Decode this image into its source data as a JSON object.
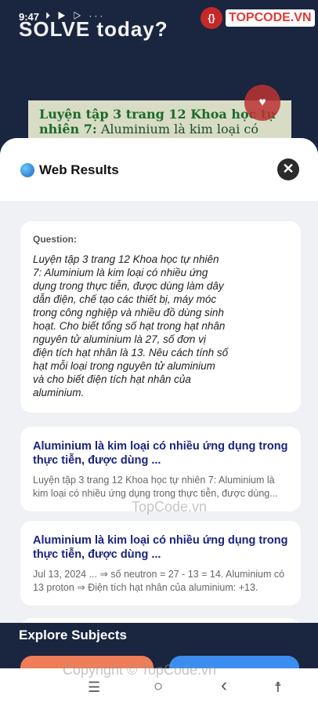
{
  "status": {
    "time": "9:47",
    "icons": "⏵ ▶ ▷ ···"
  },
  "background": {
    "title": "SOLVE today?",
    "card_highlight": "Luyện tập 3 trang 12 Khoa học tự nhiên 7:",
    "card_rest": " Aluminium là kim loại có"
  },
  "logo": {
    "badge": "{}",
    "text": "TOPCODE.VN"
  },
  "sheet": {
    "title": "Web Results",
    "close_icon": "✕"
  },
  "question": {
    "label": "Question:",
    "text": "Luyện tập 3 trang 12 Khoa học tự nhiên 7: Aluminium là kim loại có nhiều ứng dụng trong thực tiễn, được dùng làm dây dẫn điện, chế tạo các thiết bị, máy móc trong công nghiệp và nhiều đồ dùng sinh hoạt. Cho biết tổng số hạt trong hạt nhân nguyên tử aluminium là 27, số đơn vị điện tích hạt nhân là 13. Nêu cách tính số hạt mỗi loại trong nguyên tử aluminium và cho biết điện tích hạt nhân của aluminium."
  },
  "results": [
    {
      "title": "Aluminium là kim loại có nhiều ứng dụng trong thực tiễn, được dùng ...",
      "snippet": "Luyện tập 3 trang 12 Khoa học tự nhiên 7: Aluminium là kim loại có nhiều ứng dụng trong thực tiễn, được dùng..."
    },
    {
      "title": "Aluminium là kim loại có nhiều ứng dụng trong thực tiễn, được dùng ...",
      "snippet": "Jul 13, 2024 ... ⇒ số neutron = 27 - 13 = 14. Aluminium có 13 proton ⇒ Điện tích hạt nhân của aluminium: +13."
    }
  ],
  "explore": {
    "title": "Explore Subjects"
  },
  "watermarks": {
    "middle": "TopCode.vn",
    "bottom": "Copyright © TopCode.vn"
  },
  "nav": {
    "menu": "☰",
    "home": "○",
    "back": "‹",
    "accessibility": "☨"
  }
}
